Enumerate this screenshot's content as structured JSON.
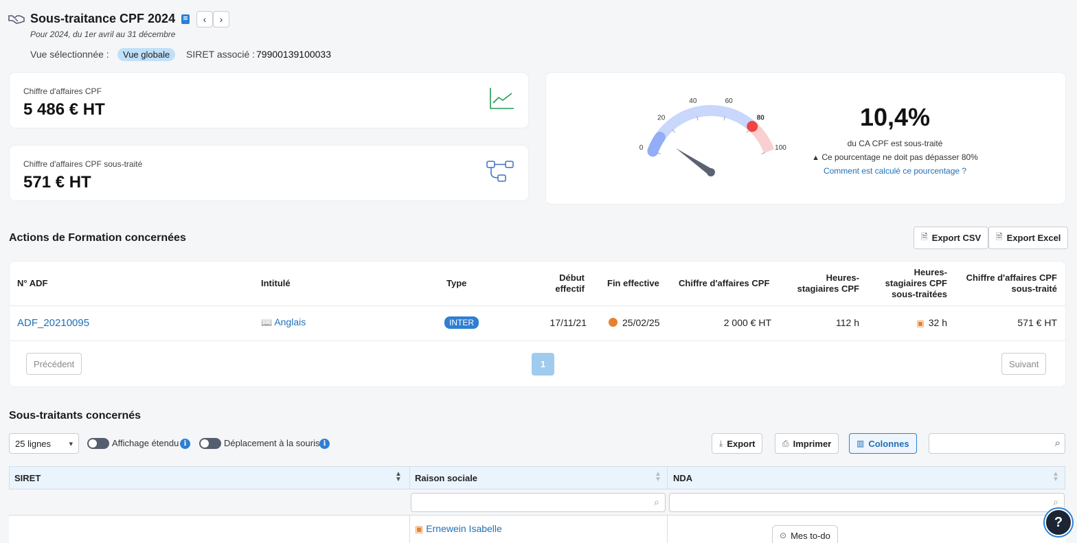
{
  "header": {
    "title": "Sous-traitance CPF 2024",
    "subtitle": "Pour 2024, du 1er avril au 31 décembre",
    "view_label": "Vue sélectionnée :",
    "view_value": "Vue globale",
    "siret_label": "SIRET associé :",
    "siret_value": "79900139100033",
    "prev": "‹",
    "next": "›"
  },
  "kpis": {
    "ca_label": "Chiffre d'affaires CPF",
    "ca_value": "5 486 € HT",
    "st_label": "Chiffre d'affaires CPF sous-traité",
    "st_value": "571 € HT"
  },
  "gauge": {
    "value": 10.4,
    "min": 0,
    "max": 100,
    "ticks": [
      "0",
      "20",
      "40",
      "60",
      "80",
      "100"
    ],
    "percent_text": "10,4%",
    "caption": "du CA CPF est sous-traité",
    "warning": "Ce pourcentage ne doit pas dépasser 80%",
    "help_link": "Comment est calculé ce pourcentage ?",
    "colors": {
      "safe": "#c8d7fb",
      "danger": "#f9cfcf",
      "marker": "#ef4444",
      "needle": "#5b6271"
    }
  },
  "actions": {
    "title": "Actions de Formation concernées",
    "export_csv": "Export CSV",
    "export_excel": "Export Excel",
    "columns": {
      "adf": "N° ADF",
      "intitule": "Intitulé",
      "type": "Type",
      "debut": "Début effectif",
      "fin": "Fin effective",
      "ca": "Chiffre d'affaires CPF",
      "heures": "Heures-stagiaires CPF",
      "heures_st": "Heures-stagiaires CPF sous-traitées",
      "ca_st": "Chiffre d'affaires CPF sous-traité"
    },
    "row": {
      "adf": "ADF_20210095",
      "intitule": "Anglais",
      "type": "INTER",
      "debut": "17/11/21",
      "fin": "25/02/25",
      "ca": "2 000 € HT",
      "heures": "112 h",
      "heures_st": "32 h",
      "ca_st": "571 € HT"
    },
    "pager": {
      "prev": "Précédent",
      "page": "1",
      "next": "Suivant"
    }
  },
  "subcontractors": {
    "title": "Sous-traitants concernés",
    "rows_select": "25 lignes",
    "toggle_extended": "Affichage étendu",
    "toggle_mouse": "Déplacement à la souris",
    "export": "Export",
    "print": "Imprimer",
    "columns_btn": "Colonnes",
    "columns": {
      "siret": "SIRET",
      "raison": "Raison sociale",
      "nda": "NDA"
    },
    "row_name": "Ernewein Isabelle",
    "todo": "Mes to-do",
    "help": "?"
  }
}
